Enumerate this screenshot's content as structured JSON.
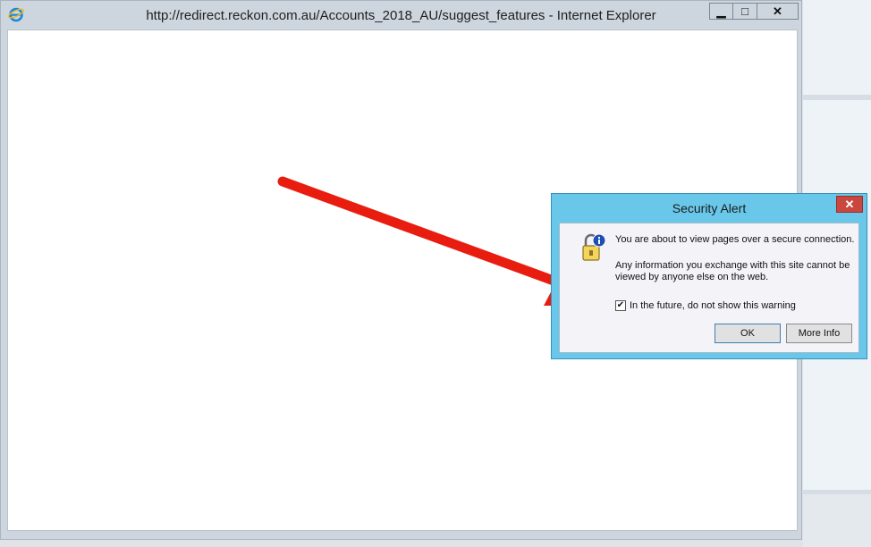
{
  "window": {
    "title": "http://redirect.reckon.com.au/Accounts_2018_AU/suggest_features - Internet Explorer",
    "minimize_label": "▁",
    "maximize_label": "□",
    "close_label": "✕"
  },
  "dialog": {
    "title": "Security Alert",
    "close_label": "✕",
    "message_primary": "You are about to view pages over a secure connection.",
    "message_secondary": "Any information you exchange with this site cannot be viewed by anyone else on the web.",
    "checkbox_label": "In the future, do not show this warning",
    "checkbox_checked": true,
    "checkmark": "✔",
    "ok_label": "OK",
    "more_info_label": "More Info"
  },
  "icons": {
    "app": "ie-logo-icon",
    "dialog": "lock-info-icon"
  },
  "colors": {
    "dialog_frame": "#69c8ea",
    "close_red": "#c9473f",
    "arrow_red": "#e81d10"
  }
}
